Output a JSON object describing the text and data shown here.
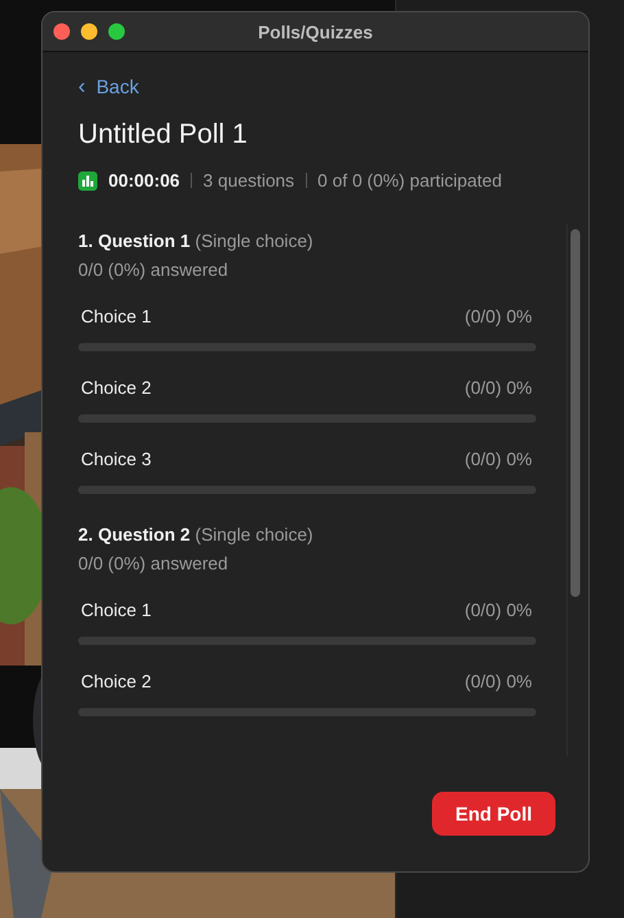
{
  "window": {
    "title": "Polls/Quizzes"
  },
  "back": {
    "icon": "‹",
    "label": "Back"
  },
  "poll": {
    "title": "Untitled Poll 1",
    "timer": "00:00:06",
    "questions_count": "3 questions",
    "participation": "0 of 0 (0%) participated"
  },
  "questions": [
    {
      "title": "1. Question 1",
      "type": "(Single choice)",
      "answered": "0/0 (0%) answered",
      "choices": [
        {
          "label": "Choice 1",
          "result": "(0/0) 0%",
          "level": 0
        },
        {
          "label": "Choice 2",
          "result": "(0/0) 0%",
          "level": 0
        },
        {
          "label": "Choice 3",
          "result": "(0/0) 0%",
          "level": 0
        }
      ]
    },
    {
      "title": "2. Question 2",
      "type": "(Single choice)",
      "answered": "0/0 (0%) answered",
      "choices": [
        {
          "label": "Choice 1",
          "result": "(0/0) 0%",
          "level": 0
        },
        {
          "label": "Choice 2",
          "result": "(0/0) 0%",
          "level": 0
        }
      ]
    }
  ],
  "buttons": [
    {
      "label": "End Poll"
    }
  ]
}
